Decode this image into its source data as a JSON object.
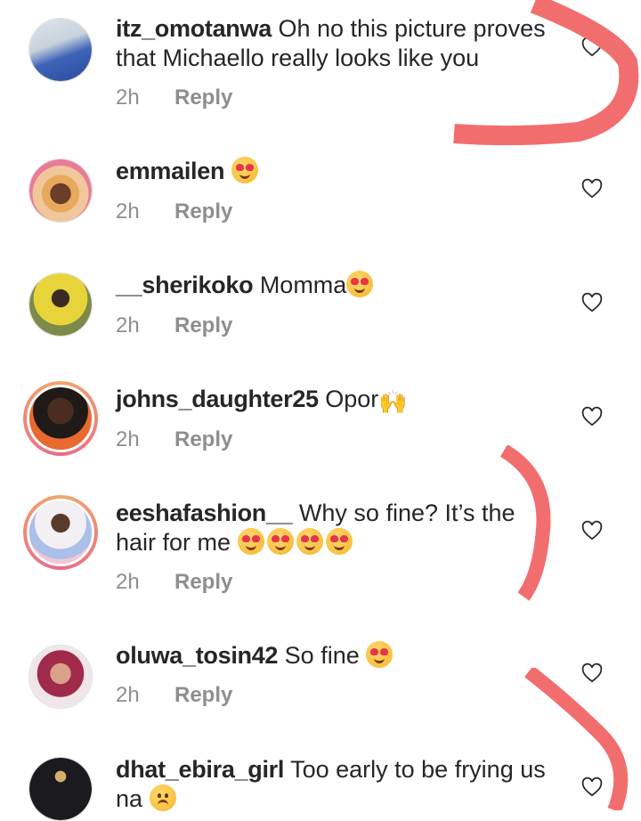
{
  "comments": [
    {
      "username": "itz_omotanwa",
      "text": "Oh no this picture proves that Michaello really looks like you",
      "time": "2h",
      "reply": "Reply"
    },
    {
      "username": "emmailen",
      "text": "",
      "time": "2h",
      "reply": "Reply",
      "emojis": [
        "heart-eyes"
      ]
    },
    {
      "username": "__sherikoko",
      "text": "Momma",
      "time": "2h",
      "reply": "Reply",
      "emojis": [
        "heart-eyes"
      ]
    },
    {
      "username": "johns_daughter25",
      "text": "Opor",
      "time": "2h",
      "reply": "Reply",
      "emojis": [
        "raising-hands"
      ]
    },
    {
      "username": "eeshafashion__",
      "text": "Why so fine? It’s the hair for me",
      "time": "2h",
      "reply": "Reply",
      "emojis": [
        "heart-eyes",
        "heart-eyes",
        "heart-eyes",
        "heart-eyes"
      ]
    },
    {
      "username": "oluwa_tosin42",
      "text": "So fine",
      "time": "2h",
      "reply": "Reply",
      "emojis": [
        "heart-eyes"
      ]
    },
    {
      "username": "dhat_ebira_girl",
      "text": "Too early to be frying us na",
      "time": "",
      "reply": "",
      "emojis": [
        "frowning-face"
      ]
    }
  ],
  "icons": {
    "like": "heart-outline-icon"
  },
  "colors": {
    "username": "#262626",
    "meta": "#8e8e8e",
    "annotation": "#f26e6e"
  }
}
